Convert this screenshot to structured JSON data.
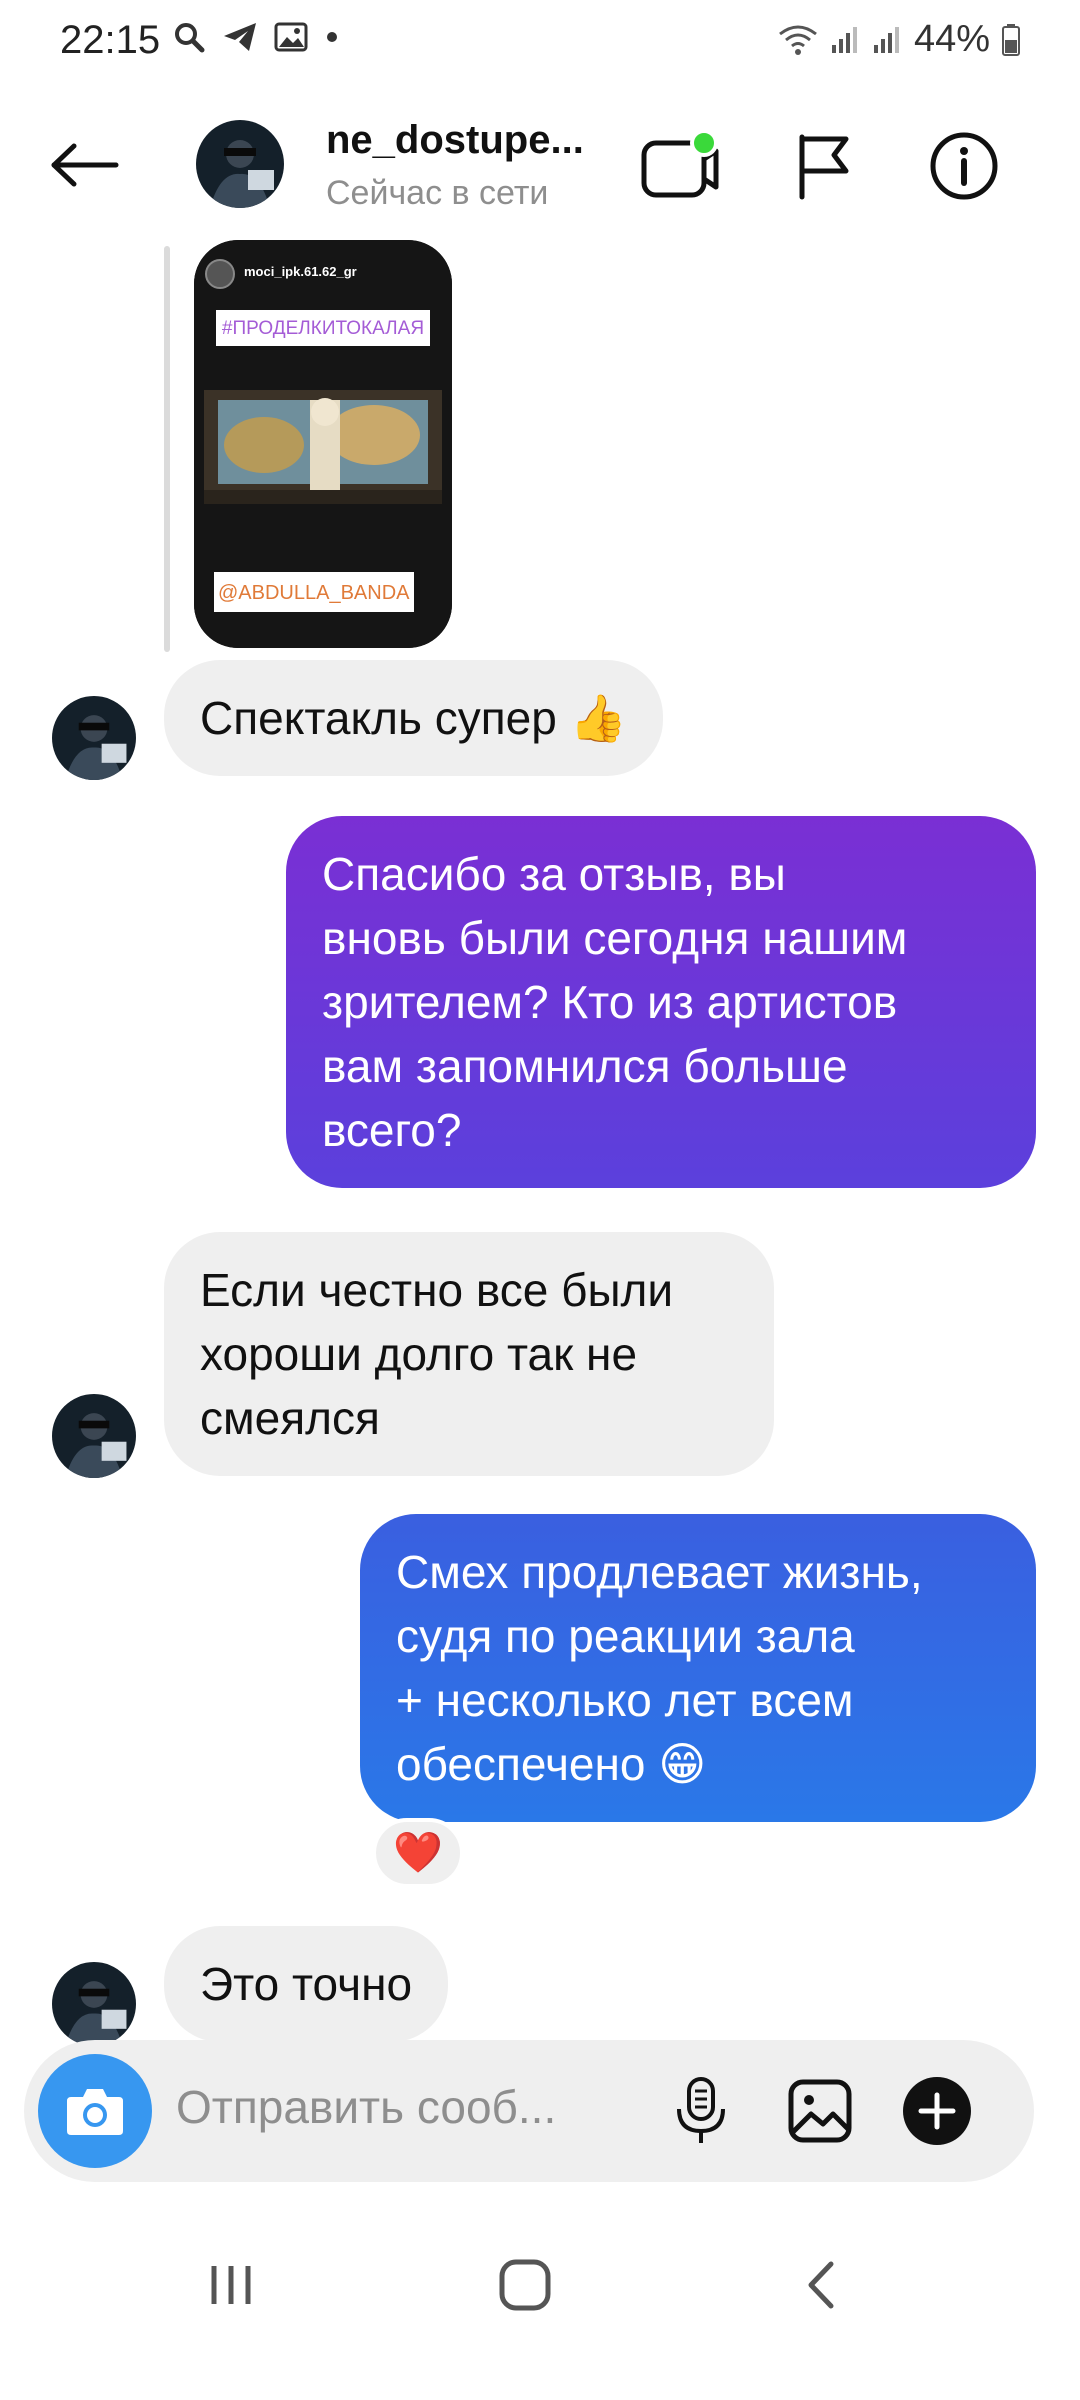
{
  "status_bar": {
    "time": "22:15",
    "battery": "44%"
  },
  "header": {
    "username": "ne_dostupe...",
    "presence": "Сейчас в сети"
  },
  "story": {
    "author": "moci_ipk.61.62_gr",
    "hashtag": "#ПРОДЕЛКИТОКАЛАЯ",
    "mention": "@ABDULLA_BANDA"
  },
  "messages": [
    {
      "direction": "in",
      "lines": [
        "Спектакль супер 👍"
      ]
    },
    {
      "direction": "out",
      "lines": [
        "Спасибо за отзыв, вы",
        "вновь были сегодня нашим",
        "зрителем? Кто из артистов",
        "вам запомнился больше",
        "всего?"
      ]
    },
    {
      "direction": "in",
      "lines": [
        "Если честно все были",
        "хороши долго так не",
        "смеялся"
      ]
    },
    {
      "direction": "out",
      "lines": [
        "Смех продлевает жизнь,",
        "судя по реакции зала",
        "+ несколько лет всем",
        "обеспечено 😁"
      ]
    },
    {
      "direction": "in",
      "lines": [
        "Это точно"
      ]
    }
  ],
  "reaction": "❤️",
  "composer": {
    "placeholder": "Отправить сооб..."
  },
  "colors": {
    "outgoing_gradient_top": "#7a2fd4",
    "outgoing_gradient_mid": "#5b40dc",
    "outgoing_blue": "#2d6fe6",
    "incoming_bubble": "#efefef",
    "camera_button": "#3797f0",
    "online_dot": "#3ad93a"
  }
}
